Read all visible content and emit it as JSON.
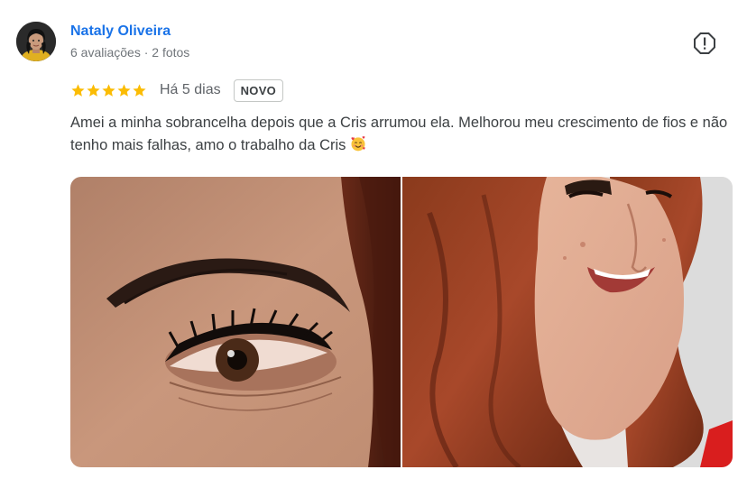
{
  "review": {
    "author": {
      "name": "Nataly Oliveira",
      "meta": "6 avaliações · 2 fotos"
    },
    "rating": 5,
    "date": "Há 5 dias",
    "badge": "NOVO",
    "text": "Amei a minha sobrancelha depois que a Cris arrumou ela. Melhorou meu crescimento de fios e não tenho mais falhas, amo o trabalho da Cris",
    "emoji": "smiling-face-with-hearts-icon",
    "photos": [
      {
        "subject": "eyebrow-closeup-photo"
      },
      {
        "subject": "smiling-woman-photo"
      }
    ]
  },
  "colors": {
    "author_link": "#1a73e8",
    "star": "#fbbc04",
    "meta_text": "#70757a",
    "body_text": "#3c4043"
  }
}
